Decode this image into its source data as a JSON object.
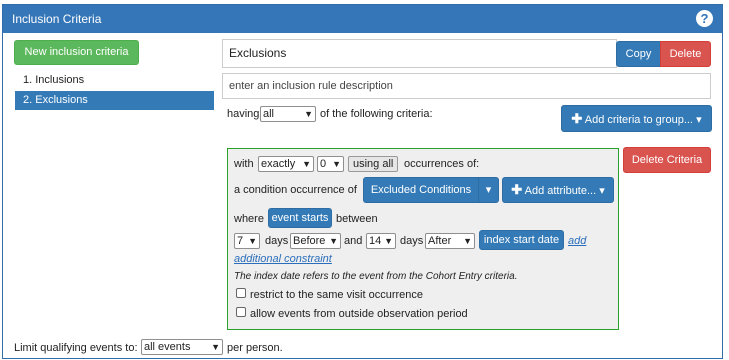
{
  "header": {
    "title": "Inclusion Criteria",
    "help_label": "?"
  },
  "left": {
    "new_button_label": "New inclusion criteria",
    "rules": [
      {
        "label": "1.  Inclusions"
      },
      {
        "label": "2.  Exclusions"
      }
    ]
  },
  "rule": {
    "name_value": "Exclusions",
    "copy_label": "Copy",
    "delete_label": "Delete",
    "description_placeholder": "enter an inclusion rule description",
    "having_label": "having",
    "having_select": "all",
    "following_label": "of the following criteria:",
    "add_criteria_label": "Add criteria to group...",
    "add_criteria_caret": "▾"
  },
  "criteria": {
    "with_label": "with",
    "occurrence_type": "exactly",
    "occurrence_count": "0",
    "using_all_label": "using all",
    "occurrences_of_label": "occurrences of:",
    "condition_label": "a condition occurrence of",
    "concept_set_label": "Excluded Conditions",
    "concept_caret": "▾",
    "add_attribute_label": "Add attribute...",
    "add_attribute_caret": "▾",
    "where_label": "where",
    "event_starts_label": "event starts",
    "between_label": "between",
    "days1_value": "7",
    "days_label": "days",
    "before_value": "Before",
    "and_label": "and",
    "days2_value": "14",
    "days2_label": "days",
    "after_value": "After",
    "index_start_label": "index start date",
    "add_link": "add",
    "additional_link": "additional constraint",
    "index_note": "The index date refers to the event from the Cohort Entry criteria.",
    "restrict_label": "restrict to the same visit occurrence",
    "allow_label": "allow events from outside observation period",
    "delete_criteria_label": "Delete Criteria"
  },
  "footer": {
    "limit_label": "Limit qualifying events to:",
    "limit_select": "all events",
    "per_person_label": "per person."
  }
}
